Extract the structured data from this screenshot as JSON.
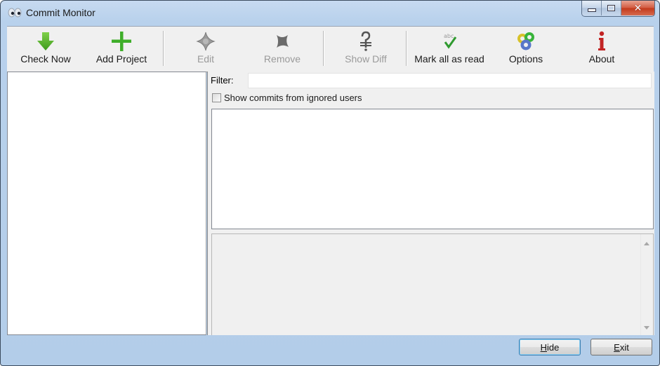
{
  "window": {
    "title": "Commit Monitor",
    "app_icon": "eyes-icon",
    "controls": {
      "minimize": "minimize-icon",
      "maximize": "maximize-icon",
      "close": "close-icon",
      "close_glyph": "✕"
    }
  },
  "toolbar": {
    "buttons": [
      {
        "label": "Check Now",
        "icon": "arrow-down-icon",
        "enabled": true,
        "color": "#4caa26"
      },
      {
        "label": "Add Project",
        "icon": "plus-icon",
        "enabled": true,
        "color": "#3fae2a"
      },
      {
        "label": "Edit",
        "icon": "edit-diamond-icon",
        "enabled": false,
        "color": "#8c8c8c"
      },
      {
        "label": "Remove",
        "icon": "x-remove-icon",
        "enabled": false,
        "color": "#6e6e6e"
      },
      {
        "label": "Show Diff",
        "icon": "show-diff-icon",
        "enabled": false,
        "color": "#555555"
      },
      {
        "label": "Mark all as read",
        "icon": "mark-read-check-icon",
        "enabled": true,
        "color": "#2f9a2f"
      },
      {
        "label": "Options",
        "icon": "options-gears-icon",
        "enabled": true,
        "color": "#5a78c8"
      },
      {
        "label": "About",
        "icon": "info-icon",
        "enabled": true,
        "color": "#c22424"
      }
    ]
  },
  "project_tree": {
    "items": []
  },
  "filter": {
    "label": "Filter:",
    "value": "",
    "placeholder": ""
  },
  "ignored_users": {
    "label": "Show commits from ignored users",
    "checked": false
  },
  "commit_list": {
    "items": []
  },
  "commit_detail": {
    "text": ""
  },
  "footer": {
    "hide": {
      "mnemonic": "H",
      "rest": "ide"
    },
    "exit": {
      "mnemonic": "E",
      "rest": "xit"
    }
  }
}
